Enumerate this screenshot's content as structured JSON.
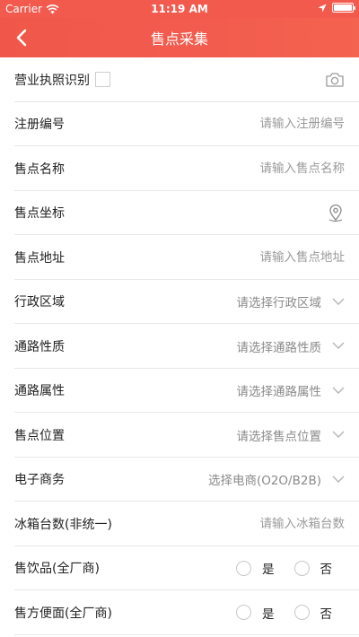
{
  "status_bar": {
    "carrier": "Carrier",
    "time": "11:19 AM"
  },
  "nav": {
    "title": "售点采集",
    "back_icon": "chevron-left-icon"
  },
  "form": {
    "license_recognition": {
      "label": "营业执照识别",
      "icon": "camera-icon"
    },
    "registration_number": {
      "label": "注册编号",
      "placeholder": "请输入注册编号"
    },
    "outlet_name": {
      "label": "售点名称",
      "placeholder": "请输入售点名称"
    },
    "outlet_coordinates": {
      "label": "售点坐标",
      "icon": "location-pin-icon"
    },
    "outlet_address": {
      "label": "售点地址",
      "placeholder": "请输入售点地址"
    },
    "admin_region": {
      "label": "行政区域",
      "value": "请选择行政区域"
    },
    "channel_nature": {
      "label": "通路性质",
      "value": "请选择通路性质"
    },
    "channel_attribute": {
      "label": "通路属性",
      "value": "请选择通路属性"
    },
    "outlet_location": {
      "label": "售点位置",
      "value": "请选择售点位置"
    },
    "ecommerce": {
      "label": "电子商务",
      "value": "选择电商(O2O/B2B)"
    },
    "fridge_count": {
      "label": "冰箱台数(非统一)",
      "placeholder": "请输入冰箱台数"
    },
    "sells_drinks": {
      "label": "售饮品(全厂商)",
      "yes": "是",
      "no": "否"
    },
    "sells_instant_noodles": {
      "label": "售方便面(全厂商)",
      "yes": "是",
      "no": "否"
    }
  },
  "colors": {
    "nav_bg": "#f25a4e",
    "placeholder": "#9a9a9a",
    "divider": "#e8e8e8"
  }
}
